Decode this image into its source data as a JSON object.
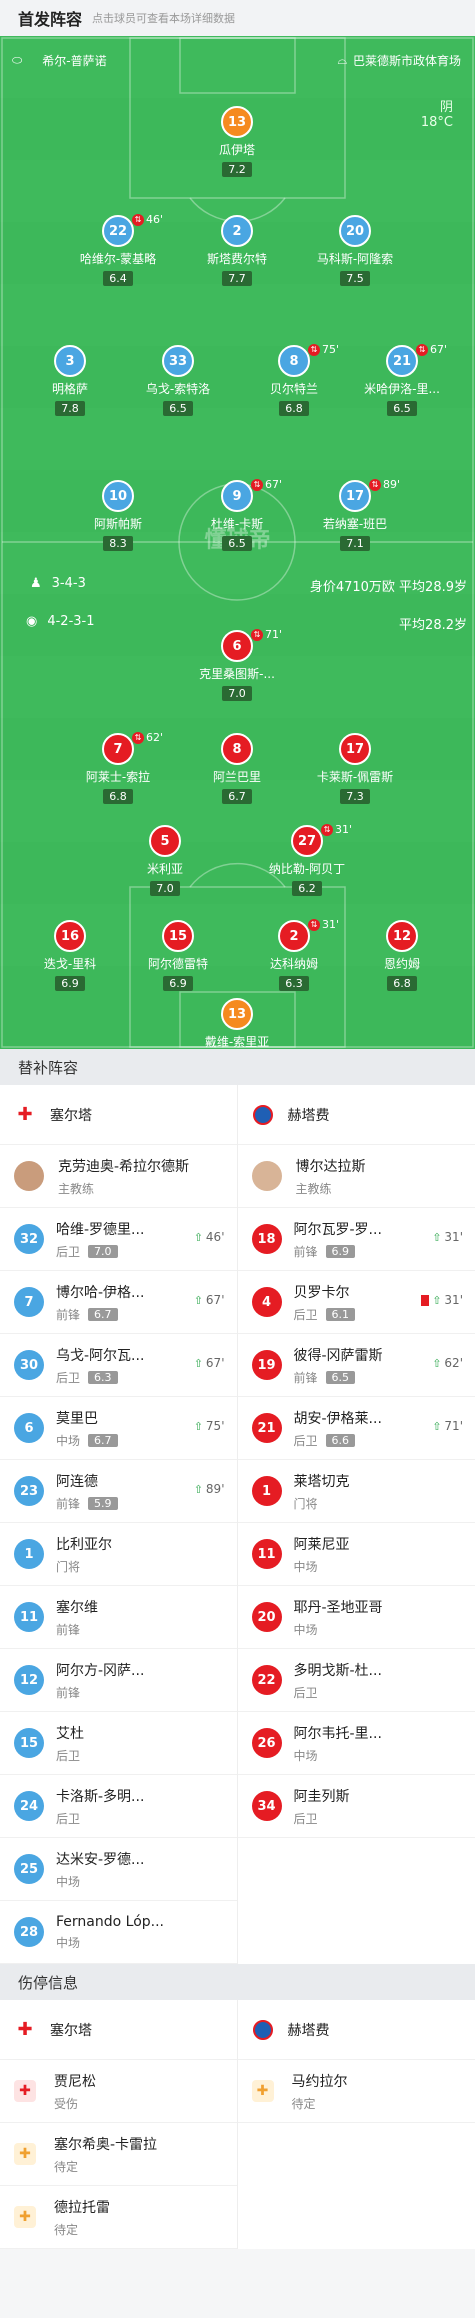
{
  "header": {
    "title": "首发阵容",
    "subtitle": "点击球员可查看本场详细数据"
  },
  "pitch": {
    "home_team": "希尔-普萨诺",
    "away_team": "巴莱德斯市政体育场",
    "weather": "阴",
    "temp": "18°C",
    "home_formation": "3-4-3",
    "away_formation": "4-2-3-1",
    "home_value": "身价4710万欧 平均28.9岁",
    "away_value": "平均28.2岁",
    "watermark": "懂球帝",
    "home_players": [
      {
        "num": "13",
        "name": "瓜伊塔",
        "rating": "7.2",
        "color": "or"
      },
      {
        "num": "22",
        "name": "哈维尔-蒙基略",
        "rating": "6.4",
        "color": "bl",
        "ev": "46'"
      },
      {
        "num": "2",
        "name": "斯塔费尔特",
        "rating": "7.7",
        "color": "bl"
      },
      {
        "num": "20",
        "name": "马科斯-阿隆索",
        "rating": "7.5",
        "color": "bl"
      },
      {
        "num": "3",
        "name": "明格萨",
        "rating": "7.8",
        "color": "bl"
      },
      {
        "num": "33",
        "name": "乌戈-索特洛",
        "rating": "6.5",
        "color": "bl"
      },
      {
        "num": "8",
        "name": "贝尔特兰",
        "rating": "6.8",
        "color": "bl",
        "ev": "75'"
      },
      {
        "num": "21",
        "name": "米哈伊洛-里...",
        "rating": "6.5",
        "color": "bl",
        "ev": "67'"
      },
      {
        "num": "10",
        "name": "阿斯帕斯",
        "rating": "8.3",
        "color": "bl"
      },
      {
        "num": "9",
        "name": "杜维-卡斯",
        "rating": "6.5",
        "color": "bl",
        "ev": "67'"
      },
      {
        "num": "17",
        "name": "若纳塞-班巴",
        "rating": "7.1",
        "color": "bl",
        "ev": "89'"
      }
    ],
    "away_players": [
      {
        "num": "6",
        "name": "克里桑图斯-...",
        "rating": "7.0",
        "color": "rd",
        "ev": "71'"
      },
      {
        "num": "7",
        "name": "阿莱士-索拉",
        "rating": "6.8",
        "color": "rd",
        "ev": "62'"
      },
      {
        "num": "8",
        "name": "阿兰巴里",
        "rating": "6.7",
        "color": "rd"
      },
      {
        "num": "17",
        "name": "卡莱斯-佩雷斯",
        "rating": "7.3",
        "color": "rd"
      },
      {
        "num": "5",
        "name": "米利亚",
        "rating": "7.0",
        "color": "rd"
      },
      {
        "num": "27",
        "name": "纳比勒-阿贝丁",
        "rating": "6.2",
        "color": "rd",
        "ev": "31'"
      },
      {
        "num": "16",
        "name": "迭戈-里科",
        "rating": "6.9",
        "color": "rd"
      },
      {
        "num": "15",
        "name": "阿尔德雷特",
        "rating": "6.9",
        "color": "rd"
      },
      {
        "num": "2",
        "name": "达科纳姆",
        "rating": "6.3",
        "color": "rd",
        "ev": "31'"
      },
      {
        "num": "12",
        "name": "恩约姆",
        "rating": "6.8",
        "color": "rd"
      },
      {
        "num": "13",
        "name": "戴维-索里亚",
        "rating": "7.0",
        "color": "or"
      }
    ]
  },
  "subs": {
    "title": "替补阵容",
    "home_team": "塞尔塔",
    "away_team": "赫塔费",
    "home_coach": {
      "name": "克劳迪奥-希拉尔德斯",
      "role": "主教练"
    },
    "away_coach": {
      "name": "博尔达拉斯",
      "role": "主教练"
    },
    "home": [
      {
        "num": "32",
        "name": "哈维-罗德里...",
        "pos": "后卫",
        "rating": "7.0",
        "time": "46'"
      },
      {
        "num": "7",
        "name": "博尔哈-伊格...",
        "pos": "前锋",
        "rating": "6.7",
        "time": "67'"
      },
      {
        "num": "30",
        "name": "乌戈-阿尔瓦...",
        "pos": "后卫",
        "rating": "6.3",
        "time": "67'"
      },
      {
        "num": "6",
        "name": "莫里巴",
        "pos": "中场",
        "rating": "6.7",
        "time": "75'"
      },
      {
        "num": "23",
        "name": "阿连德",
        "pos": "前锋",
        "rating": "5.9",
        "time": "89'"
      },
      {
        "num": "1",
        "name": "比利亚尔",
        "pos": "门将"
      },
      {
        "num": "11",
        "name": "塞尔维",
        "pos": "前锋"
      },
      {
        "num": "12",
        "name": "阿尔方-冈萨...",
        "pos": "前锋"
      },
      {
        "num": "15",
        "name": "艾杜",
        "pos": "后卫"
      },
      {
        "num": "24",
        "name": "卡洛斯-多明...",
        "pos": "后卫"
      },
      {
        "num": "25",
        "name": "达米安-罗德...",
        "pos": "中场"
      },
      {
        "num": "28",
        "name": "Fernando Lóp...",
        "pos": "中场"
      }
    ],
    "away": [
      {
        "num": "18",
        "name": "阿尔瓦罗-罗...",
        "pos": "前锋",
        "rating": "6.9",
        "time": "31'"
      },
      {
        "num": "4",
        "name": "贝罗卡尔",
        "pos": "后卫",
        "rating": "6.1",
        "time": "31'",
        "card": true
      },
      {
        "num": "19",
        "name": "彼得-冈萨雷斯",
        "pos": "前锋",
        "rating": "6.5",
        "time": "62'"
      },
      {
        "num": "21",
        "name": "胡安-伊格莱...",
        "pos": "后卫",
        "rating": "6.6",
        "time": "71'"
      },
      {
        "num": "1",
        "name": "莱塔切克",
        "pos": "门将"
      },
      {
        "num": "11",
        "name": "阿莱尼亚",
        "pos": "中场"
      },
      {
        "num": "20",
        "name": "耶丹-圣地亚哥",
        "pos": "中场"
      },
      {
        "num": "22",
        "name": "多明戈斯-杜...",
        "pos": "后卫"
      },
      {
        "num": "26",
        "name": "阿尔韦托-里...",
        "pos": "中场"
      },
      {
        "num": "34",
        "name": "阿圭列斯",
        "pos": "后卫"
      }
    ]
  },
  "injuries": {
    "title": "伤停信息",
    "home_team": "塞尔塔",
    "away_team": "赫塔费",
    "home": [
      {
        "name": "贾尼松",
        "status": "受伤",
        "icon": "injury-icon"
      },
      {
        "name": "塞尔希奥-卡雷拉",
        "status": "待定",
        "icon": "doubt-icon"
      },
      {
        "name": "德拉托雷",
        "status": "待定",
        "icon": "doubt-icon"
      }
    ],
    "away": [
      {
        "name": "马约拉尔",
        "status": "待定",
        "icon": "doubt-icon"
      }
    ]
  }
}
